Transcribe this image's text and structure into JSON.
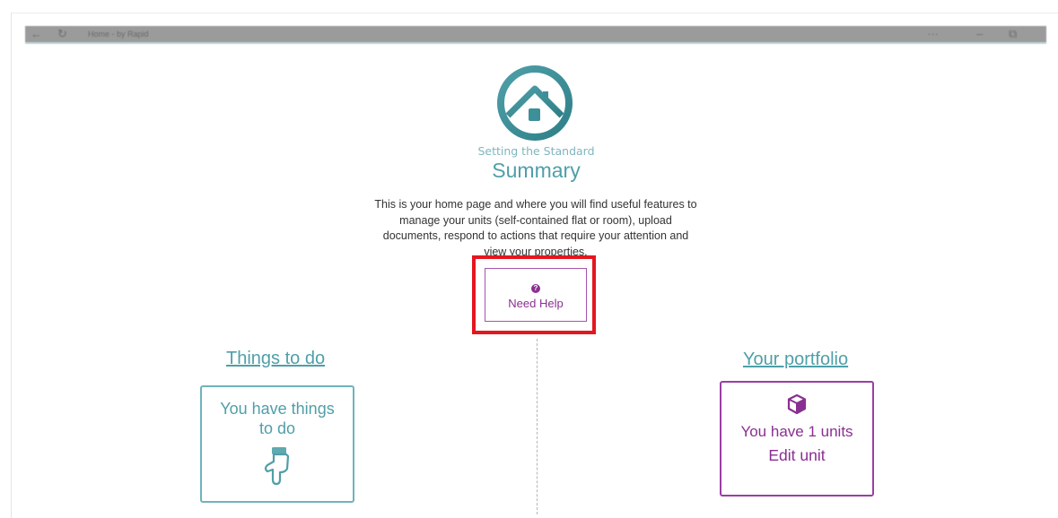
{
  "window": {
    "title": "Home - by Rapid",
    "back_icon": "←",
    "refresh_icon": "↻",
    "more_icon": "···",
    "minimize_icon": "–",
    "restore_icon": "⧉"
  },
  "brand": {
    "tagline": "Setting the Standard",
    "accent_color": "#4f9fa8",
    "secondary_color": "#8a2f92"
  },
  "header": {
    "title": "Summary",
    "intro": "This is your home page and where you will find useful features to manage your units (self-contained flat or room), upload documents, respond to actions that require your attention and view your properties."
  },
  "help": {
    "icon": "?",
    "label": "Need Help",
    "highlight_color": "#e4161f"
  },
  "todo": {
    "heading": "Things to do",
    "card_text": "You have things to do",
    "icon": "pointing-hand-icon"
  },
  "portfolio": {
    "heading": "Your portfolio",
    "units_text": "You have 1 units",
    "edit_label": "Edit unit",
    "icon": "cube-icon"
  }
}
